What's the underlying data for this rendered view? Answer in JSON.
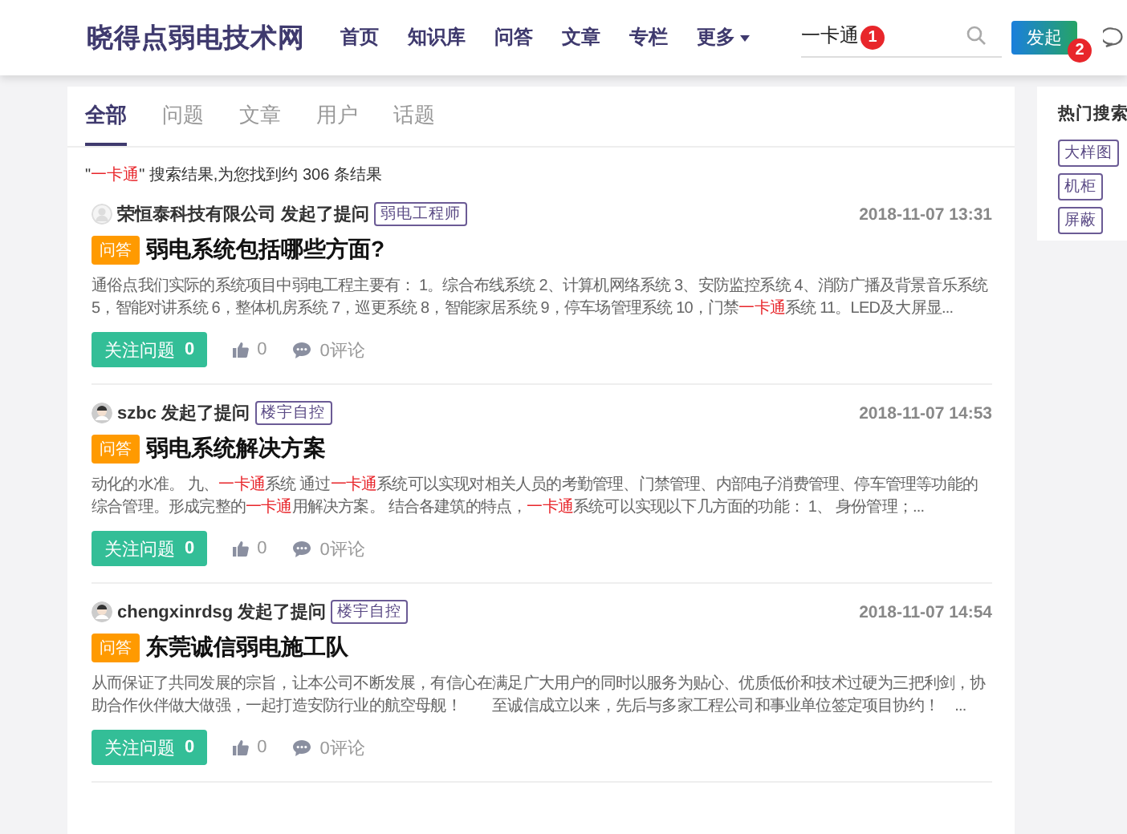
{
  "header": {
    "logo": "晓得点弱电技术网",
    "nav": [
      {
        "label": "首页",
        "dropdown": false
      },
      {
        "label": "知识库",
        "dropdown": false
      },
      {
        "label": "问答",
        "dropdown": false
      },
      {
        "label": "文章",
        "dropdown": false
      },
      {
        "label": "专栏",
        "dropdown": false
      },
      {
        "label": "更多",
        "dropdown": true
      }
    ],
    "search": {
      "value": "一卡通",
      "marker": "1"
    },
    "action_button": {
      "label": "发起",
      "marker": "2"
    }
  },
  "tabs": [
    {
      "label": "全部",
      "selected": true
    },
    {
      "label": "问题",
      "selected": false
    },
    {
      "label": "文章",
      "selected": false
    },
    {
      "label": "用户",
      "selected": false
    },
    {
      "label": "话题",
      "selected": false
    }
  ],
  "summary": [
    {
      "text": "\"",
      "highlight": false
    },
    {
      "text": "一卡通",
      "highlight": true
    },
    {
      "text": "\" 搜索结果,为您找到约 306 条结果",
      "highlight": false
    }
  ],
  "results": [
    {
      "author": "荣恒泰科技有限公司 发起了提问",
      "avatar": {
        "kind": "blank"
      },
      "topic": "弱电工程师",
      "time": "2018-11-07 13:31",
      "type_label": "问答",
      "title": "弱电系统包括哪些方面?",
      "excerpt": [
        {
          "text": "通俗点我们实际的系统项目中弱电工程主要有： 1。综合布线系统 2、计算机网络系统 3、安防监控系统 4、消防广播及背景音乐系统 5，智能对讲系统 6，整体机房系统 7，巡更系统 8，智能家居系统 9，停车场管理系统 10，门禁",
          "highlight": false
        },
        {
          "text": "一卡通",
          "highlight": true
        },
        {
          "text": "系统 11。LED及大屏显...",
          "highlight": false
        }
      ],
      "follow": "关注问题",
      "follow_count": "0",
      "likes": "0",
      "comments": "0评论"
    },
    {
      "author": "szbc 发起了提问",
      "avatar": {
        "kind": "person"
      },
      "topic": "楼宇自控",
      "time": "2018-11-07 14:53",
      "type_label": "问答",
      "title": "弱电系统解决方案",
      "excerpt": [
        {
          "text": "动化的水准。 九、",
          "highlight": false
        },
        {
          "text": "一卡通",
          "highlight": true
        },
        {
          "text": "系统 通过",
          "highlight": false
        },
        {
          "text": "一卡通",
          "highlight": true
        },
        {
          "text": "系统可以实现对相关人员的考勤管理、门禁管理、内部电子消费管理、停车管理等功能的综合管理。形成完整的",
          "highlight": false
        },
        {
          "text": "一卡通",
          "highlight": true
        },
        {
          "text": "用解决方案。 结合各建筑的特点，",
          "highlight": false
        },
        {
          "text": "一卡通",
          "highlight": true
        },
        {
          "text": "系统可以实现以下几方面的功能： 1、 身份管理；...",
          "highlight": false
        }
      ],
      "follow": "关注问题",
      "follow_count": "0",
      "likes": "0",
      "comments": "0评论"
    },
    {
      "author": "chengxinrdsg 发起了提问",
      "avatar": {
        "kind": "person"
      },
      "topic": "楼宇自控",
      "time": "2018-11-07 14:54",
      "type_label": "问答",
      "title": "东莞诚信弱电施工队",
      "excerpt": [
        {
          "text": "从而保证了共同发展的宗旨，让本公司不断发展，有信心在满足广大用户的同时以服务为贴心、优质低价和技术过硬为三把利剑，协助合作伙伴做大做强，一起打造安防行业的航空母舰！　　至诚信成立以来，先后与多家工程公司和事业单位签定项目协约！　...",
          "highlight": false
        }
      ],
      "follow": "关注问题",
      "follow_count": "0",
      "likes": "0",
      "comments": "0评论"
    }
  ],
  "sidebar": {
    "title": "热门搜索",
    "tags": [
      {
        "label": "大样图"
      },
      {
        "label": "机柜"
      },
      {
        "label": "屏蔽"
      }
    ]
  }
}
